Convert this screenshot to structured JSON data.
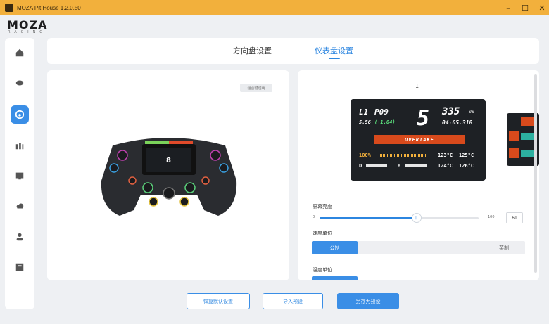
{
  "window": {
    "title": "MOZA Pit House 1.2.0.50"
  },
  "brand": {
    "logo": "MOZA",
    "sub": "RACING"
  },
  "tabs": [
    {
      "label": "方向盘设置"
    },
    {
      "label": "仪表盘设置"
    }
  ],
  "left_panel": {
    "hint_button": "组合键说明"
  },
  "dash_preview": {
    "page": "1",
    "lap": "L1",
    "pos": "P09",
    "gear": "5",
    "speed": "335",
    "speed_unit": "KPH",
    "gap": "5.56",
    "delta": "(+1.04)",
    "laptime": "04:65.318",
    "banner": "OVERTAKE",
    "fuel": "100%",
    "temp1": "123°C",
    "temp2": "125°C",
    "temp3": "124°C",
    "temp4": "126°C",
    "d_label": "D",
    "h_label": "H"
  },
  "brightness": {
    "label": "屏幕亮度",
    "min": "0",
    "max": "100",
    "value": "61",
    "fraction": 0.61
  },
  "speed_unit": {
    "label": "速度单位",
    "options": [
      "公制",
      "英制"
    ],
    "selected": "公制"
  },
  "temp_unit": {
    "label": "温度单位"
  },
  "footer": {
    "reset": "恢复默认设置",
    "import": "导入预设",
    "save_as": "另存为预设"
  }
}
